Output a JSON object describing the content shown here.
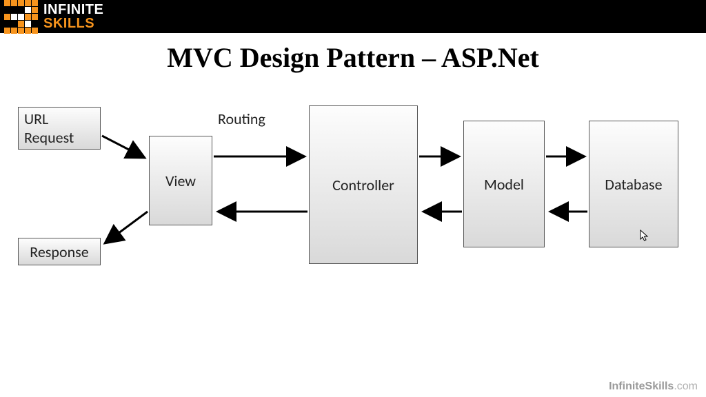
{
  "header": {
    "logo_line1": "INFINITE",
    "logo_line2": "SKILLS"
  },
  "title": "MVC Design Pattern – ASP.Net",
  "boxes": {
    "url_request": "URL Request",
    "response": "Response",
    "view": "View",
    "controller": "Controller",
    "model": "Model",
    "database": "Database"
  },
  "labels": {
    "routing": "Routing"
  },
  "footer": {
    "brand": "InfiniteSkills",
    "suffix": ".com"
  },
  "arrows": [
    {
      "from": "url_request",
      "to": "view",
      "dir": "forward"
    },
    {
      "from": "view",
      "to": "response",
      "dir": "forward"
    },
    {
      "from": "view",
      "to": "controller",
      "dir": "forward",
      "label": "routing"
    },
    {
      "from": "controller",
      "to": "view",
      "dir": "back"
    },
    {
      "from": "controller",
      "to": "model",
      "dir": "forward"
    },
    {
      "from": "model",
      "to": "controller",
      "dir": "back"
    },
    {
      "from": "model",
      "to": "database",
      "dir": "forward"
    },
    {
      "from": "database",
      "to": "model",
      "dir": "back"
    }
  ]
}
